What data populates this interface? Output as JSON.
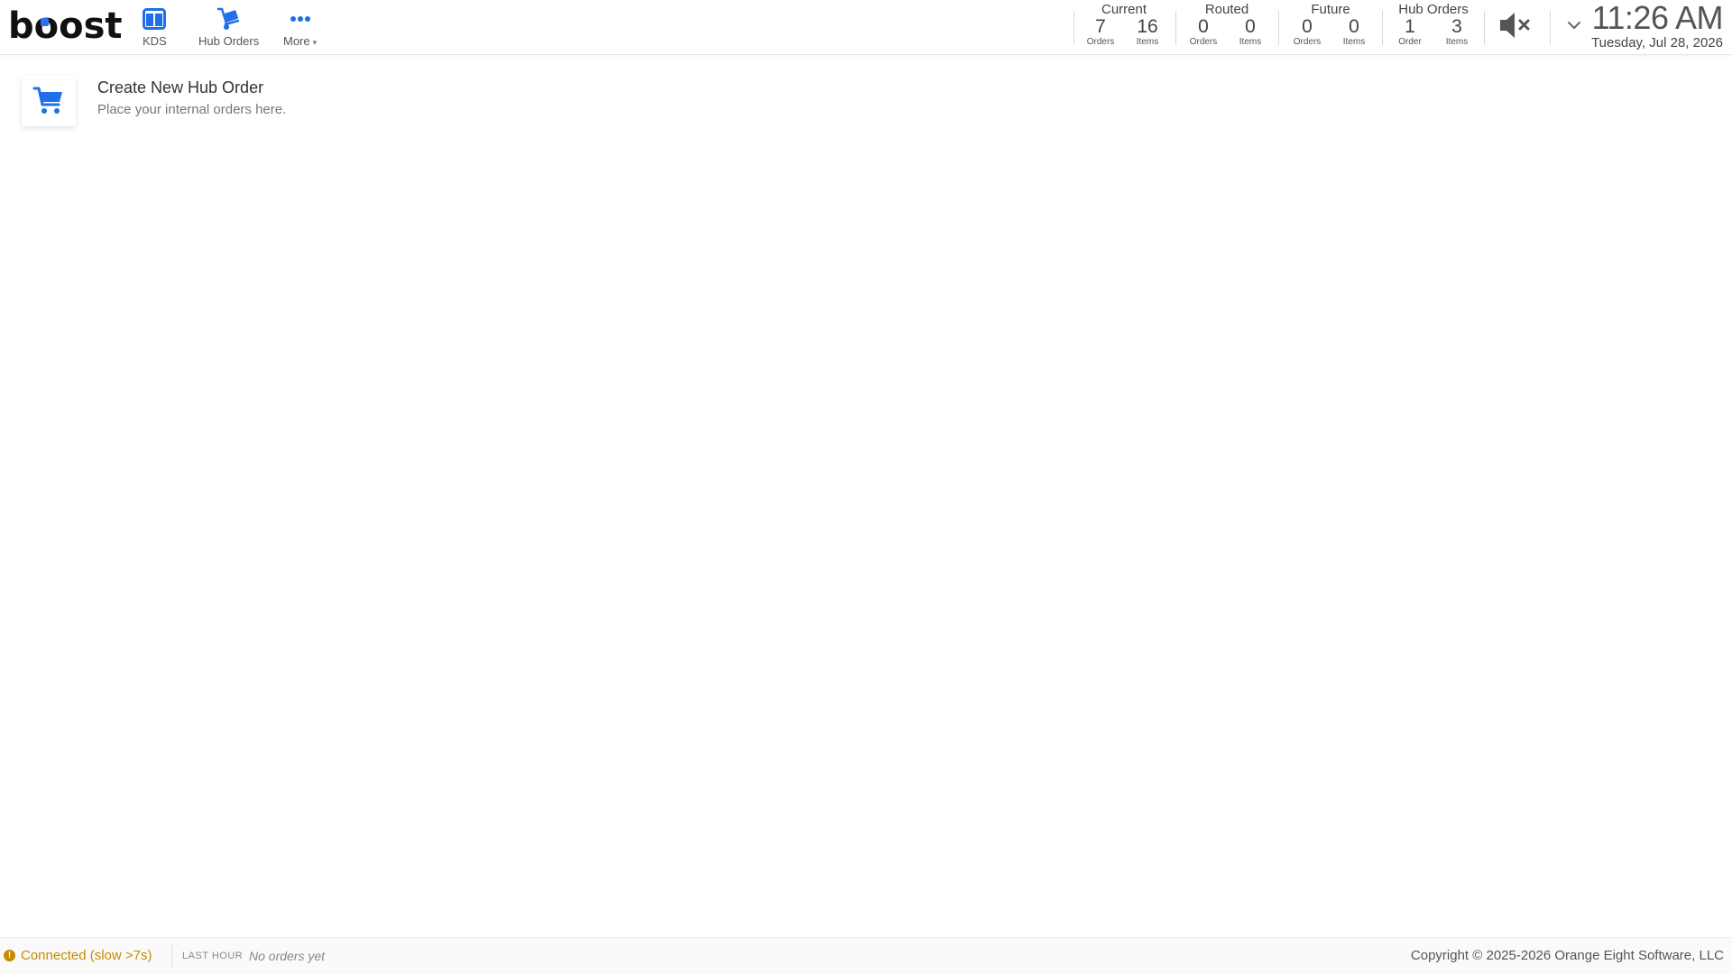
{
  "header": {
    "logo_text_a": "b",
    "logo_text_b": "o",
    "logo_text_c": "ost",
    "nav": [
      {
        "label": "KDS",
        "icon": "kds-icon"
      },
      {
        "label": "Hub Orders",
        "icon": "hand-truck-icon"
      },
      {
        "label": "More",
        "icon": "ellipsis-icon"
      }
    ],
    "stats": [
      {
        "title": "Current",
        "a_num": "7",
        "a_unit": "Orders",
        "b_num": "16",
        "b_unit": "Items"
      },
      {
        "title": "Routed",
        "a_num": "0",
        "a_unit": "Orders",
        "b_num": "0",
        "b_unit": "Items"
      },
      {
        "title": "Future",
        "a_num": "0",
        "a_unit": "Orders",
        "b_num": "0",
        "b_unit": "Items"
      },
      {
        "title": "Hub Orders",
        "a_num": "1",
        "a_unit": "Order",
        "b_num": "3",
        "b_unit": "Items"
      }
    ],
    "mute_icon": "speaker-mute-icon",
    "chevron_icon": "chevron-down-icon",
    "time": "11:26 AM",
    "date": "Tuesday, Jul 28, 2026"
  },
  "main": {
    "create_title": "Create New Hub Order",
    "create_subtitle": "Place your internal orders here.",
    "create_icon": "cart-icon"
  },
  "footer": {
    "connection_status": "Connected (slow >7s)",
    "last_hour_label": "LAST HOUR",
    "last_hour_value": "No orders yet",
    "copyright": "Copyright © 2025-2026 Orange Eight Software, LLC"
  },
  "colors": {
    "accent": "#1f6fe8",
    "warning": "#c68a00"
  }
}
